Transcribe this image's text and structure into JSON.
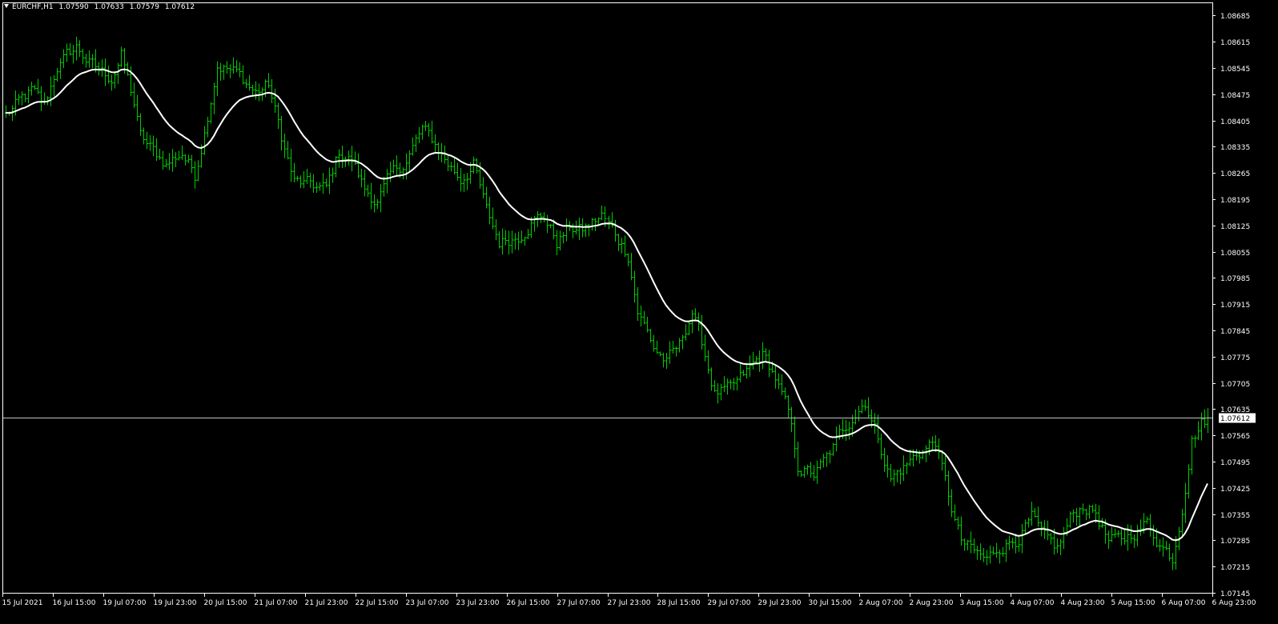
{
  "header": {
    "symbol": "EURCHF,H1",
    "open": "1.07590",
    "high": "1.07633",
    "low": "1.07579",
    "close": "1.07612"
  },
  "colors": {
    "background": "#000000",
    "bars": "#00cc00",
    "ma_line": "#ffffff",
    "axis": "#ffffff",
    "current_price_line": "#c0c0c0",
    "price_tag_bg": "#ffffff",
    "price_tag_text": "#000000"
  },
  "chart_data": {
    "type": "ohlc",
    "timeframe": "H1",
    "ylim": [
      1.07145,
      1.0872
    ],
    "y_ticks": [
      "1.08685",
      "1.08615",
      "1.08545",
      "1.08475",
      "1.08405",
      "1.08335",
      "1.08265",
      "1.08195",
      "1.08125",
      "1.08055",
      "1.07985",
      "1.07915",
      "1.07845",
      "1.07775",
      "1.07705",
      "1.07635",
      "1.07565",
      "1.07495",
      "1.07425",
      "1.07355",
      "1.07285",
      "1.07215",
      "1.07145"
    ],
    "x_ticks": [
      "15 Jul 2021",
      "16 Jul 15:00",
      "19 Jul 07:00",
      "19 Jul 23:00",
      "20 Jul 15:00",
      "21 Jul 07:00",
      "21 Jul 23:00",
      "22 Jul 15:00",
      "23 Jul 07:00",
      "23 Jul 23:00",
      "26 Jul 15:00",
      "27 Jul 07:00",
      "27 Jul 23:00",
      "28 Jul 15:00",
      "29 Jul 07:00",
      "29 Jul 23:00",
      "30 Jul 15:00",
      "2 Aug 07:00",
      "2 Aug 23:00",
      "3 Aug 15:00",
      "4 Aug 07:00",
      "4 Aug 23:00",
      "5 Aug 15:00",
      "6 Aug 07:00",
      "6 Aug 23:00"
    ],
    "current_price": "1.07612",
    "bar_count": 376,
    "bar_anchors": [
      [
        0,
        1.0842
      ],
      [
        8,
        1.0848
      ],
      [
        12,
        1.0844
      ],
      [
        16,
        1.0855
      ],
      [
        22,
        1.086
      ],
      [
        28,
        1.0854
      ],
      [
        33,
        1.0852
      ],
      [
        36,
        1.0858
      ],
      [
        40,
        1.0845
      ],
      [
        42,
        1.0836
      ],
      [
        46,
        1.0832
      ],
      [
        50,
        1.0829
      ],
      [
        55,
        1.0832
      ],
      [
        59,
        1.0826
      ],
      [
        62,
        1.0838
      ],
      [
        66,
        1.0856
      ],
      [
        72,
        1.0853
      ],
      [
        78,
        1.0848
      ],
      [
        82,
        1.085
      ],
      [
        86,
        1.0836
      ],
      [
        90,
        1.0824
      ],
      [
        95,
        1.0823
      ],
      [
        100,
        1.0822
      ],
      [
        104,
        1.0832
      ],
      [
        108,
        1.083
      ],
      [
        112,
        1.0822
      ],
      [
        116,
        1.0819
      ],
      [
        120,
        1.0825
      ],
      [
        125,
        1.083
      ],
      [
        130,
        1.0838
      ],
      [
        134,
        1.0834
      ],
      [
        138,
        1.0829
      ],
      [
        142,
        1.0825
      ],
      [
        146,
        1.0829
      ],
      [
        150,
        1.0816
      ],
      [
        154,
        1.0808
      ],
      [
        160,
        1.081
      ],
      [
        164,
        1.0814
      ],
      [
        168,
        1.0815
      ],
      [
        172,
        1.0808
      ],
      [
        176,
        1.0812
      ],
      [
        180,
        1.0811
      ],
      [
        186,
        1.0815
      ],
      [
        190,
        1.081
      ],
      [
        194,
        1.0805
      ],
      [
        197,
        1.079
      ],
      [
        202,
        1.078
      ],
      [
        206,
        1.0776
      ],
      [
        210,
        1.078
      ],
      [
        214,
        1.079
      ],
      [
        218,
        1.0778
      ],
      [
        221,
        1.0768
      ],
      [
        226,
        1.0768
      ],
      [
        230,
        1.0772
      ],
      [
        236,
        1.0778
      ],
      [
        240,
        1.0772
      ],
      [
        244,
        1.0762
      ],
      [
        247,
        1.0748
      ],
      [
        252,
        1.0746
      ],
      [
        256,
        1.075
      ],
      [
        260,
        1.0756
      ],
      [
        264,
        1.0762
      ],
      [
        268,
        1.0766
      ],
      [
        272,
        1.0756
      ],
      [
        276,
        1.0745
      ],
      [
        280,
        1.0748
      ],
      [
        285,
        1.0752
      ],
      [
        290,
        1.0755
      ],
      [
        294,
        1.074
      ],
      [
        298,
        1.0728
      ],
      [
        302,
        1.0725
      ],
      [
        306,
        1.0723
      ],
      [
        310,
        1.0727
      ],
      [
        315,
        1.0729
      ],
      [
        320,
        1.0734
      ],
      [
        324,
        1.0728
      ],
      [
        328,
        1.0726
      ],
      [
        332,
        1.0734
      ],
      [
        336,
        1.0738
      ],
      [
        340,
        1.0736
      ],
      [
        344,
        1.0728
      ],
      [
        348,
        1.0728
      ],
      [
        352,
        1.0731
      ],
      [
        356,
        1.0733
      ],
      [
        360,
        1.0728
      ],
      [
        364,
        1.0724
      ],
      [
        367,
        1.0738
      ],
      [
        370,
        1.0756
      ],
      [
        373,
        1.076
      ],
      [
        375,
        1.0761
      ]
    ]
  }
}
